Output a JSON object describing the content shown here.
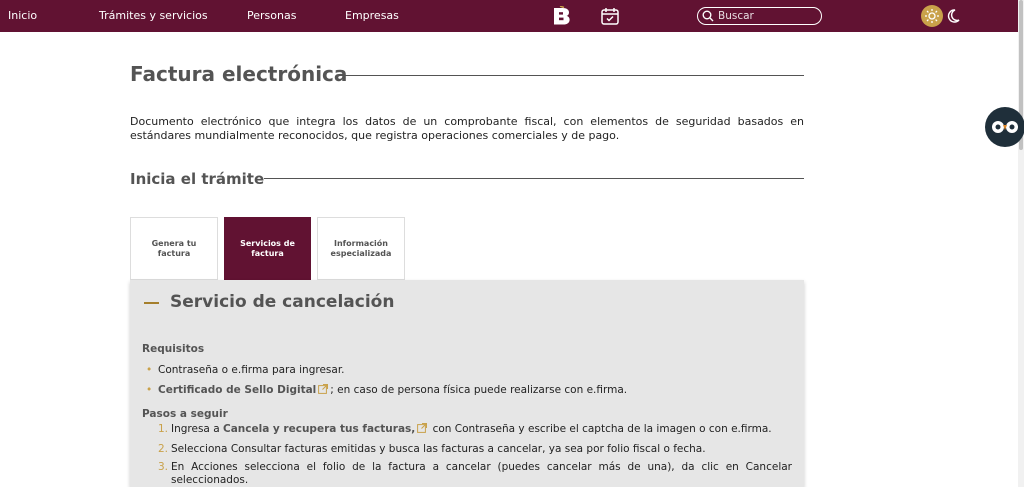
{
  "nav": {
    "links": [
      "Inicio",
      "Trámites y servicios",
      "Personas",
      "Empresas"
    ],
    "search_placeholder": "Buscar"
  },
  "page": {
    "title": "Factura electrónica",
    "description": "Documento electrónico que integra los datos de un comprobante fiscal, con elementos de seguridad basados en estándares mundialmente reconocidos, que registra operaciones comerciales y de pago.",
    "section_title": "Inicia el trámite"
  },
  "tabs": [
    {
      "label": "Genera tu factura",
      "active": false
    },
    {
      "label": "Servicios de factura",
      "active": true
    },
    {
      "label": "Información especializada",
      "active": false
    }
  ],
  "panel": {
    "title": "Servicio de cancelación",
    "requisitos_title": "Requisitos",
    "requisitos": [
      {
        "text": "Contraseña o e.firma para ingresar."
      },
      {
        "link": "Certificado de Sello Digital",
        "text": "; en caso de persona física puede realizarse con e.firma."
      }
    ],
    "pasos_title": "Pasos a seguir",
    "pasos": [
      {
        "num": "1.",
        "prefix": "Ingresa a ",
        "link": "Cancela y recupera tus facturas,",
        "text": " con Contraseña y escribe el captcha de la imagen o con e.firma."
      },
      {
        "num": "2.",
        "text": "Selecciona Consultar facturas emitidas y busca las facturas a cancelar, ya sea por folio fiscal o fecha."
      },
      {
        "num": "3.",
        "text": "En Acciones selecciona el folio de la factura a cancelar (puedes cancelar más de una), da clic en Cancelar seleccionados."
      }
    ]
  },
  "colors": {
    "brand": "#611232",
    "accent": "#c9a14a",
    "panel_bg": "#e6e6e6"
  }
}
